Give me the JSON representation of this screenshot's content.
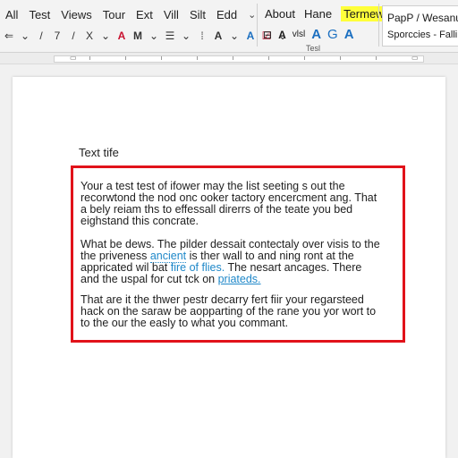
{
  "menu": {
    "items": [
      "All",
      "Test",
      "Views",
      "Tour",
      "Ext",
      "Vill",
      "Silt",
      "Edd"
    ],
    "more_icon": "chevron-down-icon"
  },
  "toolbar": {
    "tools": [
      "⇐",
      "⌄",
      "/",
      "7",
      "/",
      "X",
      "⌄",
      "A",
      "M",
      "⌄",
      "☰",
      "⌄",
      "⁞",
      "A",
      "⌄",
      "A",
      "☑",
      "⌄"
    ]
  },
  "ribbon_group": {
    "tabs": [
      "About",
      "Hane",
      "Termew"
    ],
    "tools": [
      "⊟",
      "A",
      "vlsl",
      "A",
      "G",
      "A"
    ],
    "group_label": "Tesl"
  },
  "styles": {
    "style1": "PapP / Wesanu",
    "style2": "Sporccies - Falli"
  },
  "document": {
    "title": "Text tife",
    "paragraphs": [
      [
        [
          {
            "t": "Your a test test of ifower may the list seeting s out the"
          }
        ],
        [
          {
            "t": "recorwtond the nod onc ooker tactory encercment ang. That"
          }
        ],
        [
          {
            "t": "a bely reiam ths to effessall direrrs of the teate you bed"
          }
        ],
        [
          {
            "t": "eighstand this concrate."
          }
        ]
      ],
      [
        [
          {
            "t": "What be dews. The pilder dessait contectaly over visis to the"
          }
        ],
        [
          {
            "t": "the priveness "
          },
          {
            "t": "ancient",
            "link": "dotted"
          },
          {
            "t": " is ther wall to and ning ront at the"
          }
        ],
        [
          {
            "t": "appricated wil bat "
          },
          {
            "t": "fire of flies.",
            "link": "plain"
          },
          {
            "t": " The nesart ancages. There"
          }
        ],
        [
          {
            "t": "and the uspal for cut tck on "
          },
          {
            "t": "priateds.",
            "link": "underline"
          }
        ]
      ],
      [
        [
          {
            "t": "That are it the thwer pestr decarry fert fiir your regarsteed"
          }
        ],
        [
          {
            "t": "hack on the saraw be aopparting of the rane you yor wort to"
          }
        ],
        [
          {
            "t": "to the our the easly to what you commant."
          }
        ]
      ]
    ]
  },
  "colors": {
    "text_box_border": "#e1121a",
    "link": "#1f88c9",
    "highlight": "#ffff3a"
  }
}
